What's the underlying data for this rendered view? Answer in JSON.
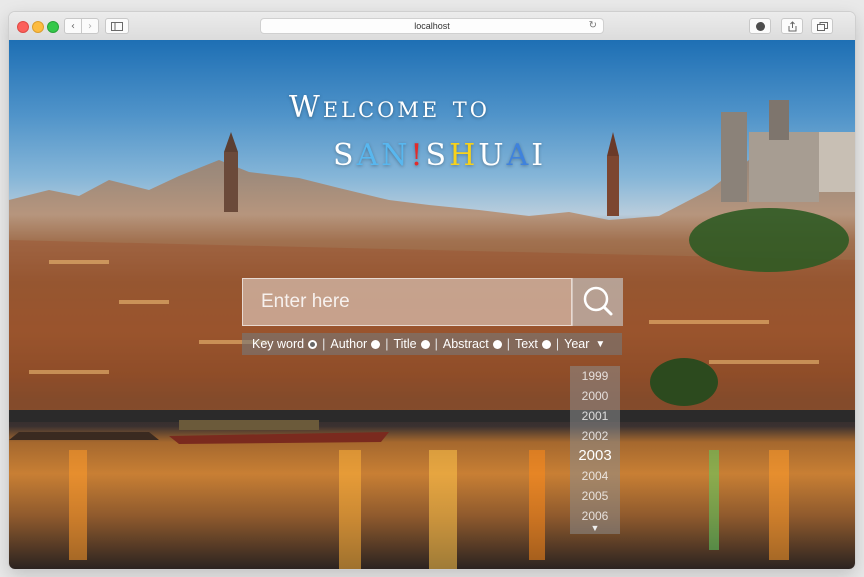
{
  "browser": {
    "address": "localhost",
    "new_tab_symbol": "+"
  },
  "hero": {
    "line1": "Welcome to",
    "brand_letters": [
      {
        "ch": "S",
        "color": "#ffffff"
      },
      {
        "ch": "A",
        "color": "#58b7ef"
      },
      {
        "ch": "N",
        "color": "#58b7ef"
      },
      {
        "ch": "!",
        "color": "#e32b2b"
      },
      {
        "ch": "S",
        "color": "#ffffff"
      },
      {
        "ch": "H",
        "color": "#f7d21b"
      },
      {
        "ch": "U",
        "color": "#ffffff"
      },
      {
        "ch": "A",
        "color": "#3f82dd"
      },
      {
        "ch": "I",
        "color": "#ffffff"
      }
    ]
  },
  "search": {
    "placeholder": "Enter here",
    "value": ""
  },
  "filters": {
    "options": [
      {
        "label": "Key word",
        "selected": true
      },
      {
        "label": "Author",
        "selected": false
      },
      {
        "label": "Title",
        "selected": false
      },
      {
        "label": "Abstract",
        "selected": false
      },
      {
        "label": "Text",
        "selected": false
      }
    ],
    "year_label": "Year",
    "year_caret": "▼"
  },
  "year_dropdown": {
    "years": [
      "1999",
      "2000",
      "2001",
      "2002",
      "2003",
      "2004",
      "2005",
      "2006"
    ],
    "selected": "2003",
    "more_arrow": "▼"
  },
  "icons": {
    "search": "search-icon",
    "back": "chevron-left-icon",
    "forward": "chevron-right-icon",
    "sidebar": "sidebar-icon",
    "reload": "reload-icon",
    "download": "download-icon",
    "share": "share-icon",
    "tabs": "tabs-icon"
  }
}
